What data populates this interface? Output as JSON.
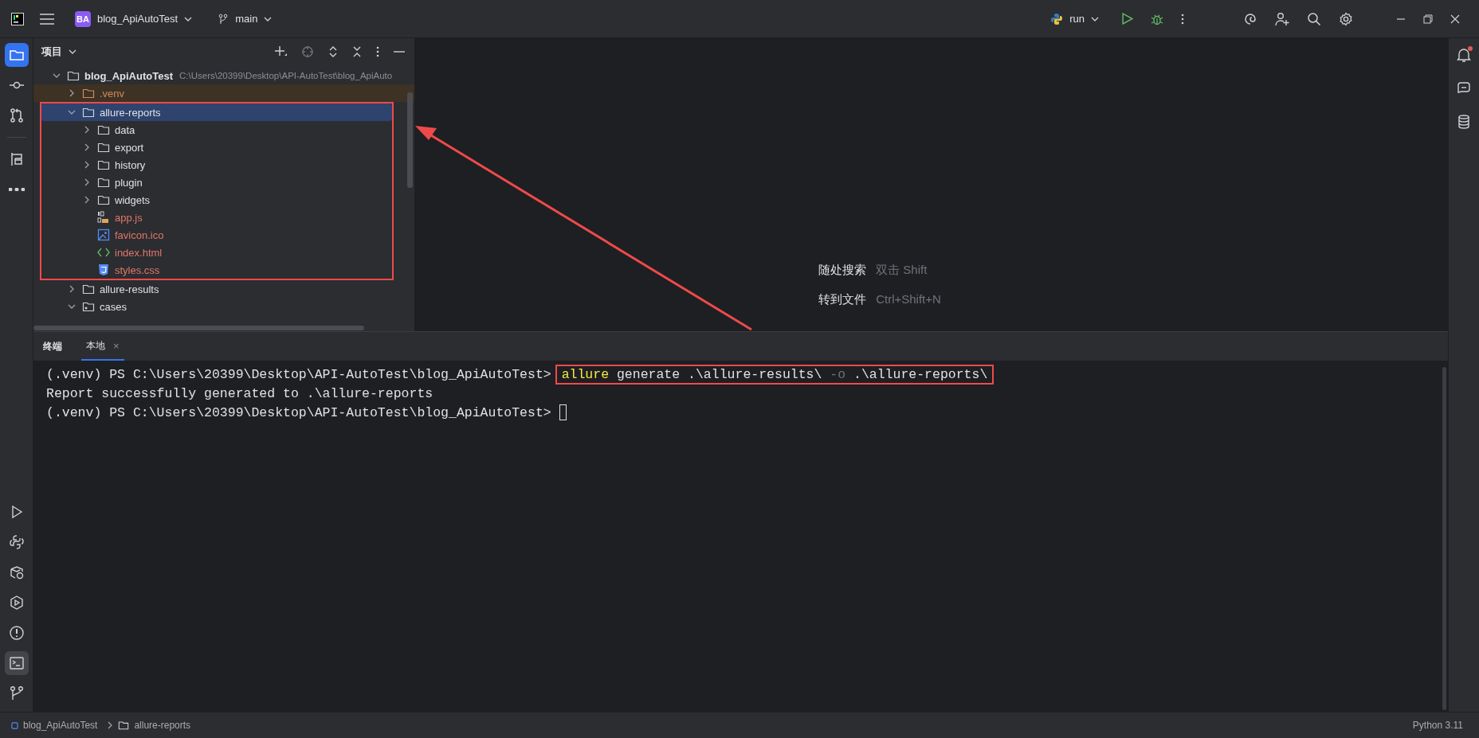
{
  "title_bar": {
    "project_badge": "BA",
    "project": "blog_ApiAutoTest",
    "branch": "main",
    "run_config": "run"
  },
  "tool_strip": {
    "top": [
      {
        "kind": "project",
        "selected": true
      },
      {
        "kind": "commit",
        "selected": false
      },
      {
        "kind": "pull_requests",
        "selected": false
      },
      {
        "kind": "structure",
        "selected": false
      },
      {
        "kind": "more",
        "selected": false
      }
    ],
    "bottom": [
      {
        "kind": "run",
        "selected": false
      },
      {
        "kind": "python_console",
        "selected": false
      },
      {
        "kind": "python_packages",
        "selected": false
      },
      {
        "kind": "services",
        "selected": false
      },
      {
        "kind": "problems",
        "selected": false
      },
      {
        "kind": "terminal",
        "selected": true
      },
      {
        "kind": "git",
        "selected": false
      }
    ]
  },
  "right_strip": [
    {
      "kind": "notifications",
      "unread": true
    },
    {
      "kind": "ai_chat",
      "unread": false
    },
    {
      "kind": "database",
      "unread": false
    }
  ],
  "project_panel": {
    "title": "项目",
    "tree": [
      {
        "name": "blog_ApiAutoTest",
        "path": "C:\\Users\\20399\\Desktop\\API-AutoTest\\blog_ApiAuto",
        "kind": "root",
        "expanded": true,
        "selected": false,
        "children": [
          {
            "name": ".venv",
            "kind": "folder",
            "excluded": true,
            "expanded": false,
            "selected": false
          },
          {
            "name": "allure-reports",
            "kind": "folder",
            "excluded": false,
            "expanded": true,
            "selected": true,
            "highlighted": true,
            "children": [
              {
                "name": "data",
                "kind": "folder",
                "unversioned": false,
                "expanded": false,
                "selected": false
              },
              {
                "name": "export",
                "kind": "folder",
                "unversioned": false,
                "expanded": false,
                "selected": false
              },
              {
                "name": "history",
                "kind": "folder",
                "unversioned": false,
                "expanded": false,
                "selected": false
              },
              {
                "name": "plugin",
                "kind": "folder",
                "unversioned": false,
                "expanded": false,
                "selected": false
              },
              {
                "name": "widgets",
                "kind": "folder",
                "unversioned": false,
                "expanded": false,
                "selected": false
              },
              {
                "name": "app.js",
                "kind": "js",
                "unversioned": true,
                "selected": false
              },
              {
                "name": "favicon.ico",
                "kind": "image",
                "unversioned": true,
                "selected": false
              },
              {
                "name": "index.html",
                "kind": "html",
                "unversioned": true,
                "selected": false
              },
              {
                "name": "styles.css",
                "kind": "css",
                "unversioned": true,
                "selected": false
              }
            ]
          },
          {
            "name": "allure-results",
            "kind": "folder",
            "excluded": false,
            "expanded": false,
            "selected": false
          },
          {
            "name": "cases",
            "kind": "package",
            "excluded": false,
            "expanded": true,
            "selected": false
          }
        ]
      }
    ]
  },
  "editor_hints": [
    {
      "action": "随处搜索",
      "shortcut": "双击 Shift"
    },
    {
      "action": "转到文件",
      "shortcut": "Ctrl+Shift+N"
    }
  ],
  "terminal": {
    "title": "终端",
    "tabs": [
      {
        "label": "本地",
        "selected": true,
        "close": "×"
      }
    ],
    "lines": [
      {
        "kind": "prompt",
        "prompt": "(.venv) PS C:\\Users\\20399\\Desktop\\API-AutoTest\\blog_ApiAutoTest>",
        "highlighted": true,
        "command": [
          {
            "text": "allure",
            "kind": "program"
          },
          {
            "text": "generate .\\allure-results\\",
            "kind": "arg"
          },
          {
            "text": "-o",
            "kind": "option"
          },
          {
            "text": ".\\allure-reports\\",
            "kind": "arg"
          }
        ]
      },
      {
        "kind": "output",
        "text": "Report successfully generated to .\\allure-reports"
      },
      {
        "kind": "prompt",
        "prompt": "(.venv) PS C:\\Users\\20399\\Desktop\\API-AutoTest\\blog_ApiAutoTest>",
        "cursor": true
      }
    ]
  },
  "status_bar": {
    "breadcrumbs": [
      "blog_ApiAutoTest",
      "allure-reports"
    ],
    "interpreter": "Python 3.11"
  }
}
